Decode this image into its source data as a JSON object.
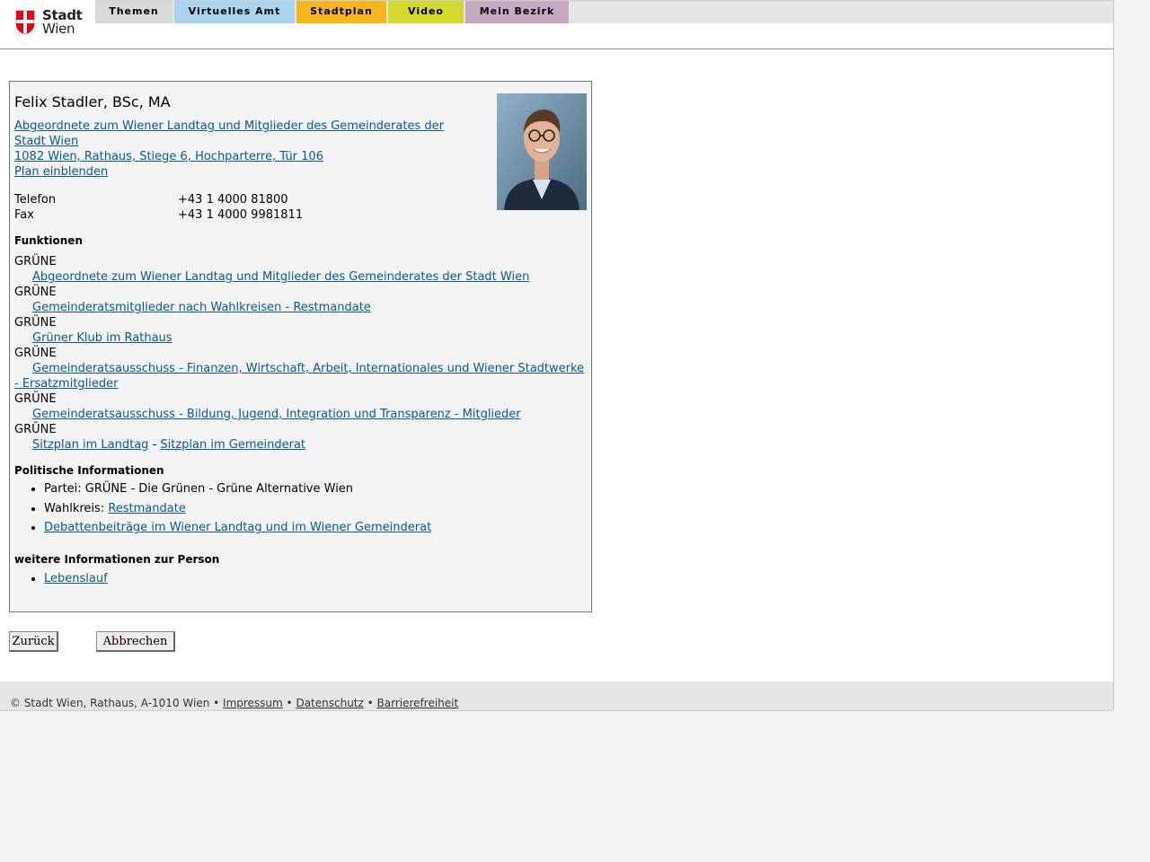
{
  "logo": {
    "line1": "Stadt",
    "line2": "Wien"
  },
  "nav": {
    "tabs": [
      {
        "label": "Themen",
        "color": "#d9d9d9"
      },
      {
        "label": "Virtuelles Amt",
        "color": "#a8d4ef"
      },
      {
        "label": "Stadtplan",
        "color": "#f5b71c"
      },
      {
        "label": "Video",
        "color": "#d3d92c"
      },
      {
        "label": "Mein Bezirk",
        "color": "#c9a8c4"
      }
    ]
  },
  "person": {
    "name": "Felix Stadler, BSc, MA",
    "role_link_line1": "Abgeordnete zum Wiener Landtag und Mitglieder des Gemeinderates der",
    "role_link_line2": "Stadt Wien ",
    "address_link": "1082 Wien, Rathaus, Stiege 6, Hochparterre, Tür 106",
    "plan_link": "Plan einblenden",
    "contact": [
      {
        "label": "Telefon",
        "value": "+43 1 4000 81800"
      },
      {
        "label": "Fax",
        "value": "+43 1 4000 9981811"
      }
    ]
  },
  "functions": {
    "title": "Funktionen",
    "items": [
      {
        "party": "GRÜNE",
        "link": "Abgeordnete zum Wiener Landtag und Mitglieder des Gemeinderates der Stadt Wien"
      },
      {
        "party": "GRÜNE",
        "link": "Gemeinderatsmitglieder nach Wahlkreisen - Restmandate"
      },
      {
        "party": "GRÜNE",
        "link": "Grüner Klub im Rathaus"
      },
      {
        "party": "GRÜNE",
        "link": "Gemeinderatsausschuss - Finanzen, Wirtschaft, Arbeit, Internationales und Wiener Stadtwerke - Ersatzmitglieder"
      },
      {
        "party": "GRÜNE",
        "link": "Gemeinderatsausschuss - Bildung, Jugend, Integration und Transparenz - Mitglieder"
      }
    ],
    "last_party": "GRÜNE",
    "seat_link_1": "Sitzplan im Landtag",
    "seat_sep": " - ",
    "seat_link_2": "Sitzplan im Gemeinderat"
  },
  "political": {
    "title": "Politische Informationen",
    "party_text": "Partei: GRÜNE - Die Grünen - Grüne Alternative Wien",
    "wahlkreis_label": "Wahlkreis: ",
    "wahlkreis_link": "Restmandate",
    "debate_link": "Debattenbeiträge im Wiener Landtag und im Wiener Gemeinderat"
  },
  "further": {
    "title": "weitere Informationen zur Person",
    "cv_link": "Lebenslauf"
  },
  "buttons": {
    "back": "Zurück",
    "cancel": "Abbrechen"
  },
  "footer": {
    "copyright": "© Stadt Wien, Rathaus, A-1010 Wien • ",
    "impressum": "Impressum",
    "sep1": " • ",
    "datenschutz": "Datenschutz",
    "sep2": " • ",
    "barrierefreiheit": "Barrierefreiheit"
  }
}
